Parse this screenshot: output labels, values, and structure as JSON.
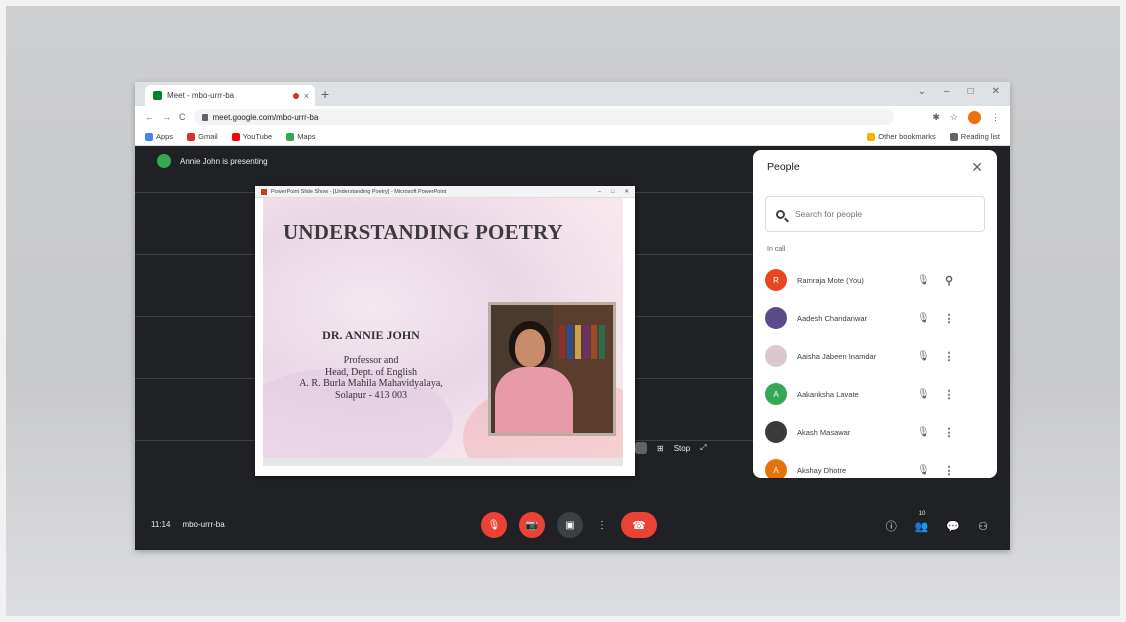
{
  "browser": {
    "tab_title": "Meet - mbo-urrr-ba",
    "close_glyph": "×",
    "newtab_glyph": "+",
    "window_controls": [
      "⌄",
      "–",
      "□",
      "✕"
    ],
    "nav": {
      "back": "←",
      "forward": "→",
      "reload": "C"
    },
    "url": "meet.google.com/mbo-urrr-ba",
    "toolbar_icons": {
      "extension": "✱",
      "star": "☆",
      "menu": "⋮"
    },
    "bookmarks": [
      "Apps",
      "Gmail",
      "YouTube",
      "Maps"
    ],
    "bookmarks_right": [
      "Other bookmarks",
      "Reading list"
    ],
    "colors": {
      "gmail": "#d93025",
      "youtube": "#ff0000",
      "maps": "#34a853",
      "apps": "#4285f4"
    }
  },
  "meet": {
    "presenting_text": "Annie John is presenting",
    "presenter_initial": "A",
    "slide_window_title": "PowerPoint Slide Show - [Understanding Poetry] - Microsoft PowerPoint",
    "slide_window_controls": [
      "–",
      "□",
      "✕"
    ],
    "slide": {
      "title": "UNDERSTANDING POETRY",
      "author": "DR. ANNIE JOHN",
      "lines": [
        "Professor and",
        "Head, Dept. of English",
        "A. R. Burla Mahila Mahavidyalaya,",
        "Solapur - 413 003"
      ]
    },
    "tile_controls": {
      "layout": "⊞",
      "caption": "Stop",
      "expand": "⤢"
    },
    "bottom": {
      "time": "11:14",
      "meeting_code": "mbo-urrr-ba",
      "buttons": {
        "mic": "🎙",
        "camera": "📷",
        "present": "▣",
        "more": "⋮",
        "end": "☎"
      },
      "right_icons": {
        "info": "ⓘ",
        "people": "👥",
        "chat": "💬",
        "activities": "⚇"
      },
      "participant_count": "10"
    },
    "people": {
      "title": "People",
      "close": "✕",
      "search_placeholder": "Search for people",
      "section": "In call",
      "icons": {
        "mic_off": "🎙",
        "pin": "⚲",
        "more": "⋮"
      },
      "list": [
        {
          "name": "Ramraja Mote (You)",
          "initial": "R",
          "color": "#e8461e"
        },
        {
          "name": "Aadesh Chandanwar",
          "initial": "",
          "color": "#5b4a8a"
        },
        {
          "name": "Aaisha Jabeen Inamdar",
          "initial": "",
          "color": "#d9c6cf"
        },
        {
          "name": "Aakanksha Lavate",
          "initial": "A",
          "color": "#34a853"
        },
        {
          "name": "Akash Masawar",
          "initial": "",
          "color": "#3a3a3a"
        },
        {
          "name": "Akshay Dhotre",
          "initial": "A",
          "color": "#e8710a"
        }
      ]
    }
  }
}
